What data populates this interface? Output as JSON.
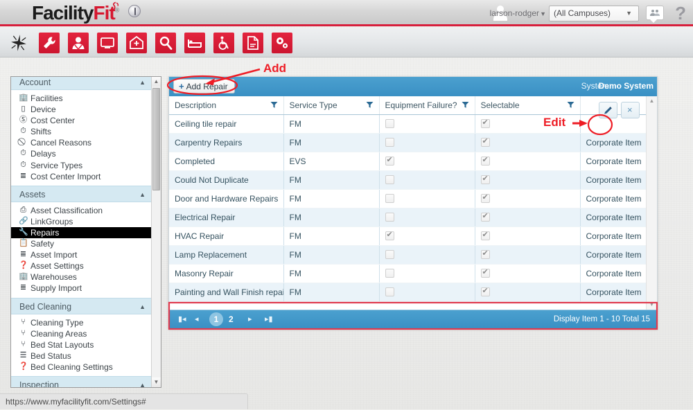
{
  "header": {
    "logo_first": "Facility",
    "logo_second": "Fit",
    "logo_tm": "®",
    "info_icon": "info-icon",
    "user_name": "larson-rodger",
    "user_caret": "▼",
    "campus_selected": "(All Campuses)",
    "campus_caret": "▼",
    "chat_icon": "chat-icon",
    "help_label": "?"
  },
  "toolbar": {
    "items": [
      {
        "name": "sparkle-star-icon",
        "label": "Sparkle"
      },
      {
        "name": "wrench-icon",
        "label": "Maintenance"
      },
      {
        "name": "person-support-icon",
        "label": "Staff"
      },
      {
        "name": "monitor-icon",
        "label": "Display"
      },
      {
        "name": "hospital-home-icon",
        "label": "Facility"
      },
      {
        "name": "magnifier-icon",
        "label": "Search"
      },
      {
        "name": "bed-icon",
        "label": "Beds"
      },
      {
        "name": "wheelchair-icon",
        "label": "Transport"
      },
      {
        "name": "document-icon",
        "label": "Reports"
      },
      {
        "name": "gears-icon",
        "label": "Settings"
      }
    ]
  },
  "sidebar": {
    "groups": [
      {
        "title": "Account",
        "caret": "▲",
        "items": [
          {
            "label": "Facilities",
            "icon": "building-icon",
            "glyph": "🏢",
            "selected": false
          },
          {
            "label": "Device",
            "icon": "device-icon",
            "glyph": "▯",
            "selected": false
          },
          {
            "label": "Cost Center",
            "icon": "dollar-circle-icon",
            "glyph": "Ⓢ",
            "selected": false
          },
          {
            "label": "Shifts",
            "icon": "clock-icon",
            "glyph": "⏱",
            "selected": false
          },
          {
            "label": "Cancel Reasons",
            "icon": "no-entry-icon",
            "glyph": "⃠",
            "selected": false
          },
          {
            "label": "Delays",
            "icon": "clock-icon",
            "glyph": "⏱",
            "selected": false
          },
          {
            "label": "Service Types",
            "icon": "clock-icon",
            "glyph": "⏱",
            "selected": false
          },
          {
            "label": "Cost Center Import",
            "icon": "layers-icon",
            "glyph": "≣",
            "selected": false
          }
        ]
      },
      {
        "title": "Assets",
        "caret": "▲",
        "items": [
          {
            "label": "Asset Classification",
            "icon": "printer-icon",
            "glyph": "⎙",
            "selected": false
          },
          {
            "label": "LinkGroups",
            "icon": "link-icon",
            "glyph": "🔗",
            "selected": false
          },
          {
            "label": "Repairs",
            "icon": "wrench-icon",
            "glyph": "🔧",
            "selected": true
          },
          {
            "label": "Safety",
            "icon": "clipboard-icon",
            "glyph": "📋",
            "selected": false
          },
          {
            "label": "Asset Import",
            "icon": "layers-icon",
            "glyph": "≣",
            "selected": false
          },
          {
            "label": "Asset Settings",
            "icon": "question-circle-icon",
            "glyph": "❓",
            "selected": false
          },
          {
            "label": "Warehouses",
            "icon": "building-icon",
            "glyph": "🏢",
            "selected": false
          },
          {
            "label": "Supply Import",
            "icon": "layers-icon",
            "glyph": "≣",
            "selected": false
          }
        ]
      },
      {
        "title": "Bed Cleaning",
        "caret": "▲",
        "items": [
          {
            "label": "Cleaning Type",
            "icon": "broom-icon",
            "glyph": "⑂",
            "selected": false
          },
          {
            "label": "Cleaning Areas",
            "icon": "hierarchy-icon",
            "glyph": "⑂",
            "selected": false
          },
          {
            "label": "Bed Stat Layouts",
            "icon": "hierarchy-icon",
            "glyph": "⑂",
            "selected": false
          },
          {
            "label": "Bed Status",
            "icon": "list-icon",
            "glyph": "☰",
            "selected": false
          },
          {
            "label": "Bed Cleaning Settings",
            "icon": "question-circle-icon",
            "glyph": "❓",
            "selected": false
          }
        ]
      },
      {
        "title": "Inspection",
        "caret": "▲",
        "items": []
      }
    ],
    "scroll_up": "▲",
    "scroll_down": "▼"
  },
  "main": {
    "add_button_label": "Add Repair",
    "add_button_plus": "+",
    "system_label": "System:",
    "system_value": "Demo System",
    "columns": [
      {
        "label": "Description",
        "filter_icon": "filter-icon"
      },
      {
        "label": "Service Type",
        "filter_icon": "filter-icon"
      },
      {
        "label": "Equipment Failure?",
        "filter_icon": "filter-icon"
      },
      {
        "label": "Selectable",
        "filter_icon": "filter-icon"
      },
      {
        "label": "",
        "filter_icon": ""
      }
    ],
    "rows": [
      {
        "description": "Ceiling tile repair",
        "service_type": "FM",
        "equipment_failure": false,
        "selectable": true,
        "owner": ""
      },
      {
        "description": "Carpentry Repairs",
        "service_type": "FM",
        "equipment_failure": false,
        "selectable": true,
        "owner": "Corporate Item"
      },
      {
        "description": "Completed",
        "service_type": "EVS",
        "equipment_failure": true,
        "selectable": true,
        "owner": "Corporate Item"
      },
      {
        "description": "Could Not Duplicate",
        "service_type": "FM",
        "equipment_failure": false,
        "selectable": true,
        "owner": "Corporate Item"
      },
      {
        "description": "Door and Hardware Repairs",
        "service_type": "FM",
        "equipment_failure": false,
        "selectable": true,
        "owner": "Corporate Item"
      },
      {
        "description": "Electrical Repair",
        "service_type": "FM",
        "equipment_failure": false,
        "selectable": true,
        "owner": "Corporate Item"
      },
      {
        "description": "HVAC Repair",
        "service_type": "FM",
        "equipment_failure": true,
        "selectable": true,
        "owner": "Corporate Item"
      },
      {
        "description": "Lamp Replacement",
        "service_type": "FM",
        "equipment_failure": false,
        "selectable": true,
        "owner": "Corporate Item"
      },
      {
        "description": "Masonry Repair",
        "service_type": "FM",
        "equipment_failure": false,
        "selectable": true,
        "owner": "Corporate Item"
      },
      {
        "description": "Painting and Wall Finish repairs",
        "service_type": "FM",
        "equipment_failure": false,
        "selectable": true,
        "owner": "Corporate Item"
      }
    ],
    "row_actions": {
      "edit_icon": "pencil-icon",
      "delete_icon": "close-x-icon",
      "delete_glyph": "×"
    },
    "pager": {
      "first": "⏮",
      "prev": "◂",
      "page_1": "1",
      "page_2": "2",
      "next": "▸",
      "last": "⏭",
      "status": "Display Item 1 - 10 Total 15"
    }
  },
  "annotations": [
    {
      "name": "add-annotation",
      "text": "Add"
    },
    {
      "name": "edit-annotation",
      "text": "Edit"
    }
  ],
  "statusbar": {
    "url": "https://www.myfacilityfit.com/Settings#"
  },
  "colors": {
    "brand_red": "#d81f3c",
    "panel_blue": "#3a90c4",
    "group_header": "#d5e9f2",
    "row_alt": "#eaf3f9",
    "annotation_red": "#ee1c25"
  }
}
